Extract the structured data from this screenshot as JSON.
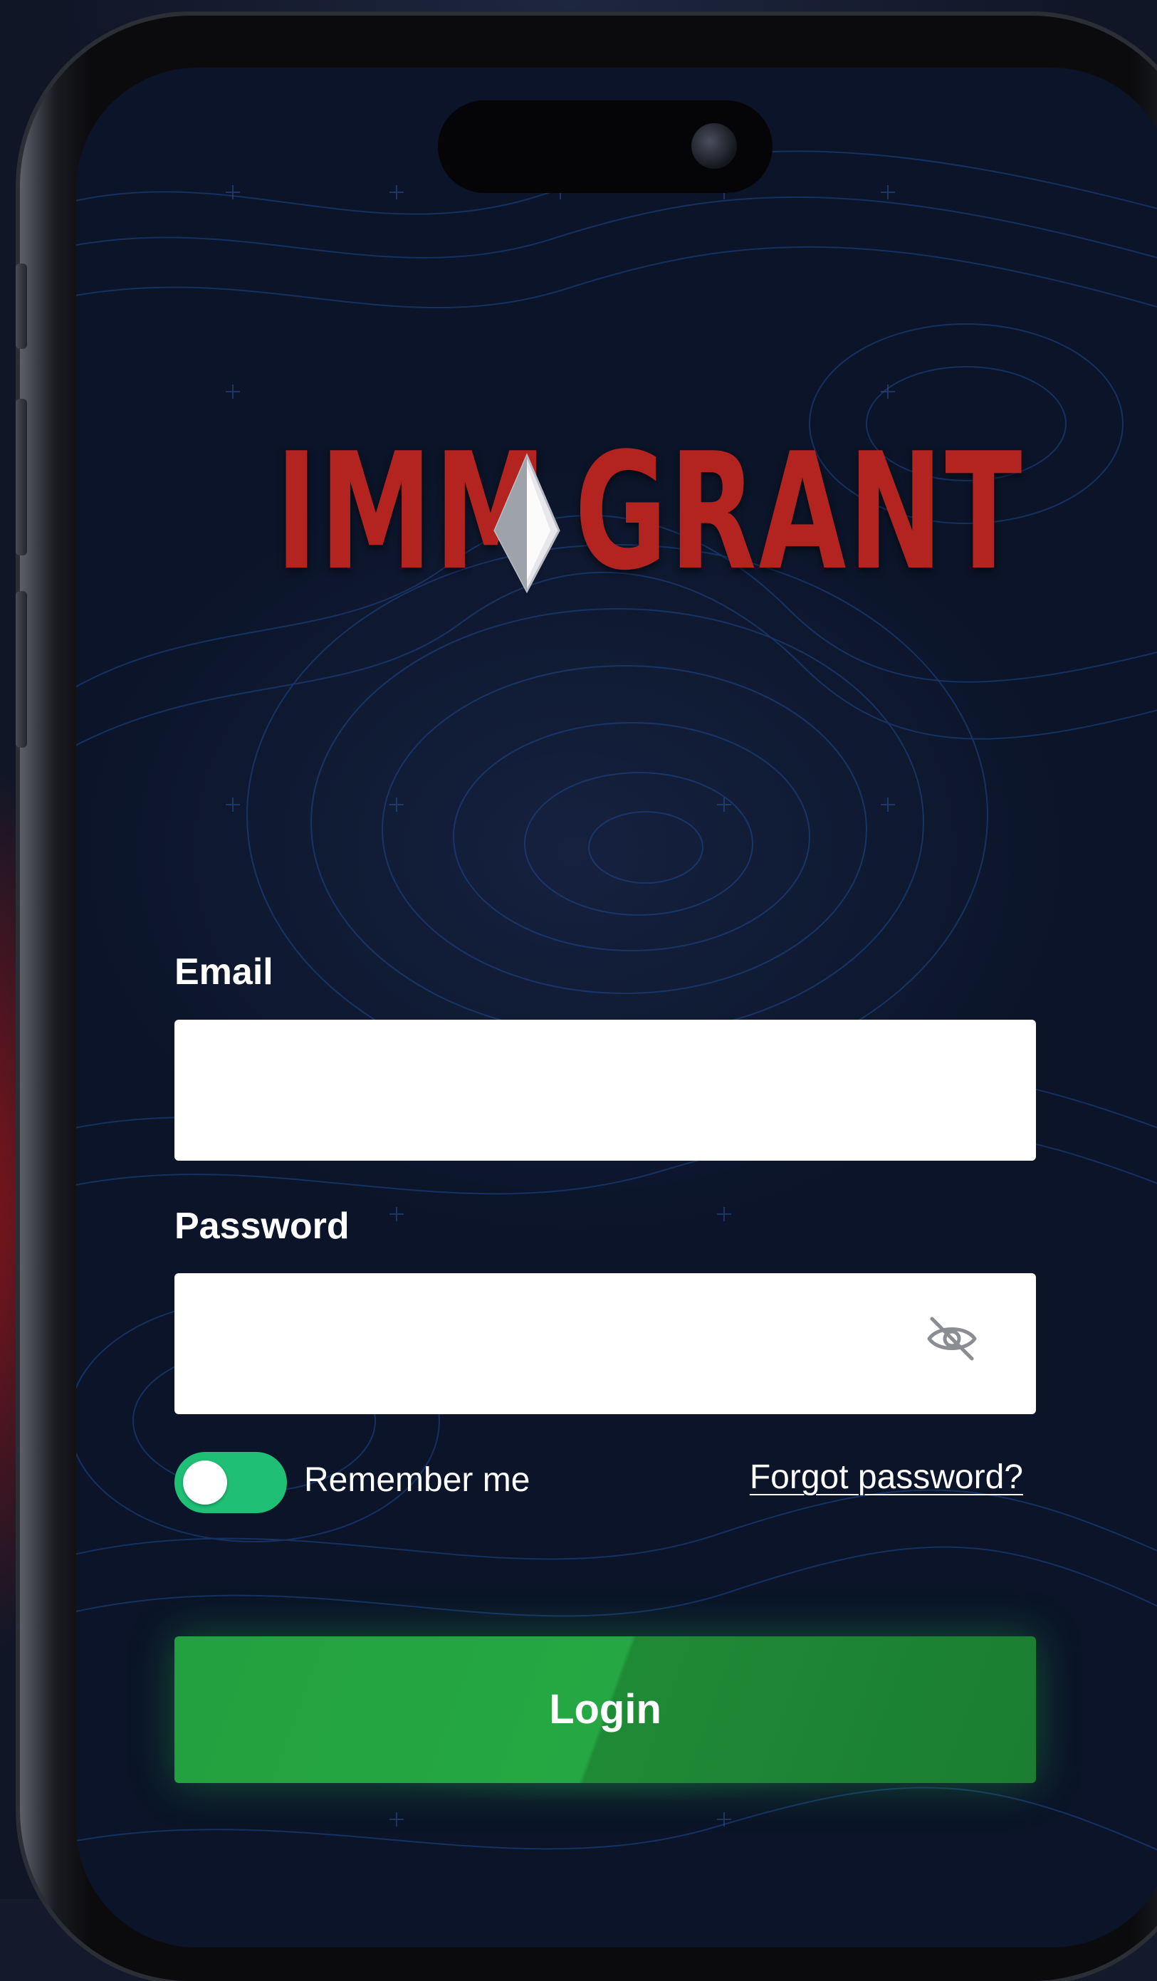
{
  "brand": {
    "logo_left": "IMM",
    "logo_right": "GRANT",
    "logo_color": "#b3231f"
  },
  "form": {
    "email_label": "Email",
    "email_value": "",
    "password_label": "Password",
    "password_value": "",
    "password_visibility_icon": "eye-off-icon",
    "remember_label": "Remember me",
    "remember_enabled": true,
    "forgot_link": "Forgot password?",
    "login_label": "Login"
  },
  "colors": {
    "toggle_on": "#1fc075",
    "login_button": "#25a843",
    "background": "#0b1428"
  }
}
